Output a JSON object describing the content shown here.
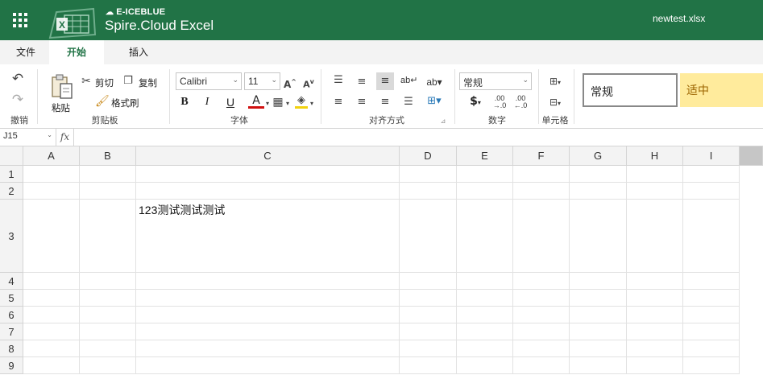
{
  "header": {
    "brand_small": "E-ICEBLUE",
    "brand_big": "Spire.Cloud Excel",
    "filename": "newtest.xlsx",
    "bg_color": "#217346"
  },
  "tabs": [
    {
      "label": "文件",
      "active": false
    },
    {
      "label": "开始",
      "active": true
    },
    {
      "label": "插入",
      "active": false
    }
  ],
  "ribbon": {
    "undo_group": {
      "label": "撤销"
    },
    "clipboard": {
      "paste": "粘贴",
      "cut": "剪切",
      "copy": "复制",
      "format_painter": "格式刷",
      "label": "剪贴板"
    },
    "font": {
      "family": "Calibri",
      "size": "11",
      "label": "字体"
    },
    "alignment": {
      "label": "对齐方式"
    },
    "number": {
      "format": "常规",
      "label": "数字"
    },
    "cells": {
      "label": "单元格"
    },
    "styles": [
      {
        "label": "常规",
        "bg": "#ffffff",
        "fg": "#222222"
      },
      {
        "label": "适中",
        "bg": "#ffeb9c",
        "fg": "#9c6500"
      }
    ]
  },
  "formula_bar": {
    "name_box": "J15",
    "fx": "fx",
    "content": ""
  },
  "sheet": {
    "columns": [
      "A",
      "B",
      "C",
      "D",
      "E",
      "F",
      "G",
      "H",
      "I"
    ],
    "rows": [
      "1",
      "2",
      "3",
      "4",
      "5",
      "6",
      "7",
      "8",
      "9"
    ],
    "cells": {
      "C3": "123测试测试测试"
    }
  }
}
